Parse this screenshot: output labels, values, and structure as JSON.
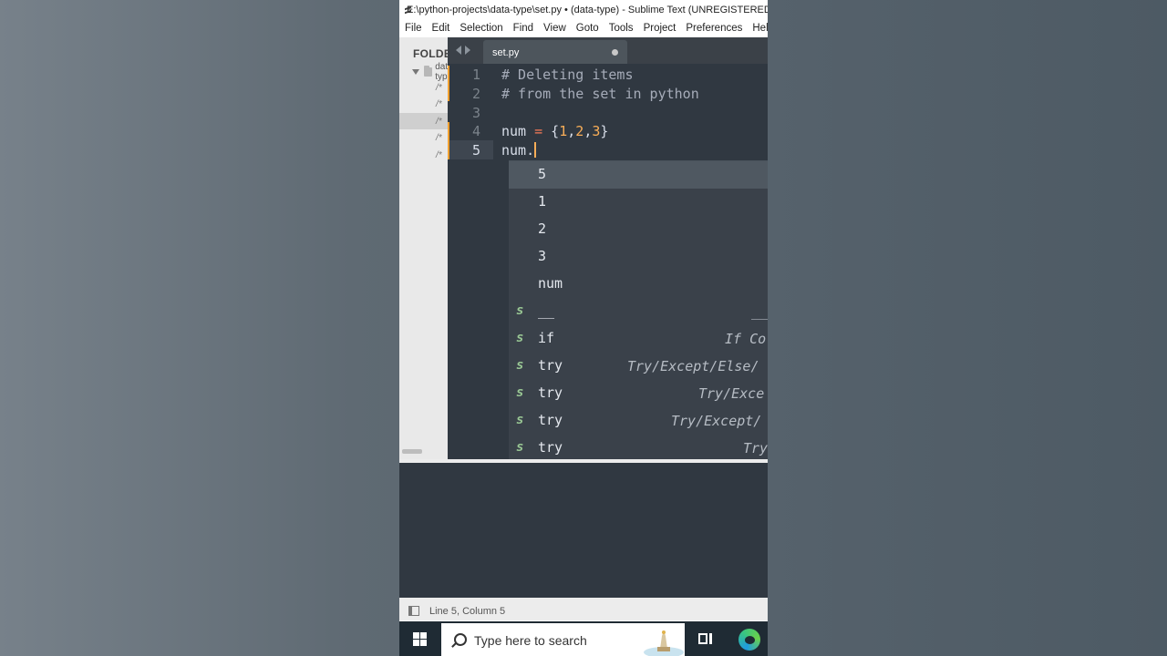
{
  "window": {
    "title": "E:\\python-projects\\data-type\\set.py • (data-type) - Sublime Text (UNREGISTERED)"
  },
  "menu": [
    "File",
    "Edit",
    "Selection",
    "Find",
    "View",
    "Goto",
    "Tools",
    "Project",
    "Preferences",
    "Help"
  ],
  "sidebar": {
    "header": "FOLDERS",
    "folder_name": "data-type",
    "file_marker": "/*"
  },
  "tab": {
    "label": "set.py"
  },
  "editor": {
    "line_numbers": [
      "1",
      "2",
      "3",
      "4",
      "5"
    ],
    "lines": {
      "l1": "# Deleting items",
      "l2": "# from the set in python",
      "l4_var": "num ",
      "l4_op": "=",
      "l4_open": " {",
      "l4_n1": "1",
      "l4_c1": ",",
      "l4_n2": "2",
      "l4_c2": ",",
      "l4_n3": "3",
      "l4_close": "}",
      "l5": "num."
    }
  },
  "autocomplete": {
    "items": [
      {
        "kind": "",
        "trigger": "5",
        "annotation": ""
      },
      {
        "kind": "",
        "trigger": "1",
        "annotation": ""
      },
      {
        "kind": "",
        "trigger": "2",
        "annotation": ""
      },
      {
        "kind": "",
        "trigger": "3",
        "annotation": ""
      },
      {
        "kind": "",
        "trigger": "num",
        "annotation": ""
      },
      {
        "kind": "s",
        "trigger": "__",
        "annotation": "__"
      },
      {
        "kind": "s",
        "trigger": "if",
        "annotation": "If Co"
      },
      {
        "kind": "s",
        "trigger": "try",
        "annotation": "Try/Except/Else/"
      },
      {
        "kind": "s",
        "trigger": "try",
        "annotation": "Try/Exce"
      },
      {
        "kind": "s",
        "trigger": "try",
        "annotation": "Try/Except/"
      },
      {
        "kind": "s",
        "trigger": "try",
        "annotation": "Try"
      }
    ]
  },
  "status": {
    "position": "Line 5, Column 5"
  },
  "taskbar": {
    "search_placeholder": "Type here to search"
  },
  "colors": {
    "accent": "#f0a030",
    "editor_bg": "#303841",
    "snippet_kind": "#99c794"
  }
}
